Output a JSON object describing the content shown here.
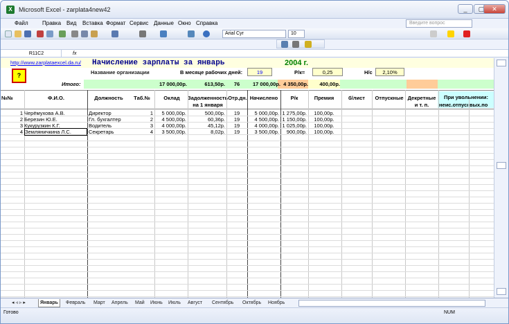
{
  "window": {
    "title": "Microsoft Excel - zarplata4new42",
    "app_icon": "X",
    "min": "_",
    "max": "▢",
    "close": "✕"
  },
  "menu": [
    "Файл",
    "Правка",
    "Вид",
    "Вставка",
    "Формат",
    "Сервис",
    "Данные",
    "Окно",
    "Справка"
  ],
  "help_placeholder": "Введите вопрос",
  "font": {
    "name": "Arial Cyr",
    "size": "10"
  },
  "name_box": "R11C2",
  "fx": "fx",
  "sheet": {
    "link": "http://www.zarplataexcel.da.ru/",
    "q_button": "?",
    "title": "Начисление зарплаты за январь",
    "year": "2004 г.",
    "org_label": "Название организации",
    "workdays_label": "В месяце рабочих дней:",
    "workdays": "19",
    "rk_label": "Р/к=",
    "rk": "0,25",
    "ns_label": "Н/с",
    "ns": "2,10%",
    "itogo_label": "Итого:",
    "itogo": {
      "oklad": "17 000,00р.",
      "debt": "613,50р.",
      "days": "76",
      "accrued": "17 000,00р.",
      "rk": "4 350,00р.",
      "bonus": "400,00р."
    },
    "headers": {
      "num": "№№",
      "fio": "Ф.И.О.",
      "position": "Должность",
      "tab": "Таб.№",
      "oklad": "Оклад",
      "debt1": "Задолженность",
      "debt2": "на 1 января",
      "days": "Отр.дн.",
      "accrued": "Начислено",
      "rk": "Р/к",
      "bonus": "Премия",
      "sick": "б/лист",
      "vac": "Отпускные",
      "decr1": "Декретные",
      "decr2": "и т. п.",
      "fire": "При увольнении:",
      "fire_a": "неис.отпуск",
      "fire_b": "вых.по"
    },
    "rows": [
      {
        "n": "1",
        "fio": "Черёмухова А.В.",
        "pos": "Директор",
        "tab": "1",
        "oklad": "5 000,00р.",
        "debt": "500,00р.",
        "days": "19",
        "acc": "5 000,00р.",
        "rk": "1 275,00р.",
        "bonus": "100,00р."
      },
      {
        "n": "2",
        "fio": "Березин Ю.Е.",
        "pos": "Гл. бухгалтер",
        "tab": "2",
        "oklad": "4 500,00р.",
        "debt": "60,36р.",
        "days": "19",
        "acc": "4 500,00р.",
        "rk": "1 150,00р.",
        "bonus": "100,00р."
      },
      {
        "n": "3",
        "fio": "Кукурузкин К.Г.",
        "pos": "Водитель",
        "tab": "3",
        "oklad": "4 000,00р.",
        "debt": "45,12р.",
        "days": "19",
        "acc": "4 000,00р.",
        "rk": "1 025,00р.",
        "bonus": "100,00р."
      },
      {
        "n": "4",
        "fio": "Земляничкина Л.С.",
        "pos": "Секретарь",
        "tab": "4",
        "oklad": "3 500,00р.",
        "debt": "8,02р.",
        "days": "19",
        "acc": "3 500,00р.",
        "rk": "900,00р.",
        "bonus": "100,00р."
      }
    ]
  },
  "tabs": [
    "Январь",
    "Февраль",
    "Март",
    "Апрель",
    "Май",
    "Июнь",
    "Июль",
    "Август",
    "Сентябрь",
    "Октябрь",
    "Ноябрь"
  ],
  "status": {
    "ready": "Готово",
    "num": "NUM"
  }
}
